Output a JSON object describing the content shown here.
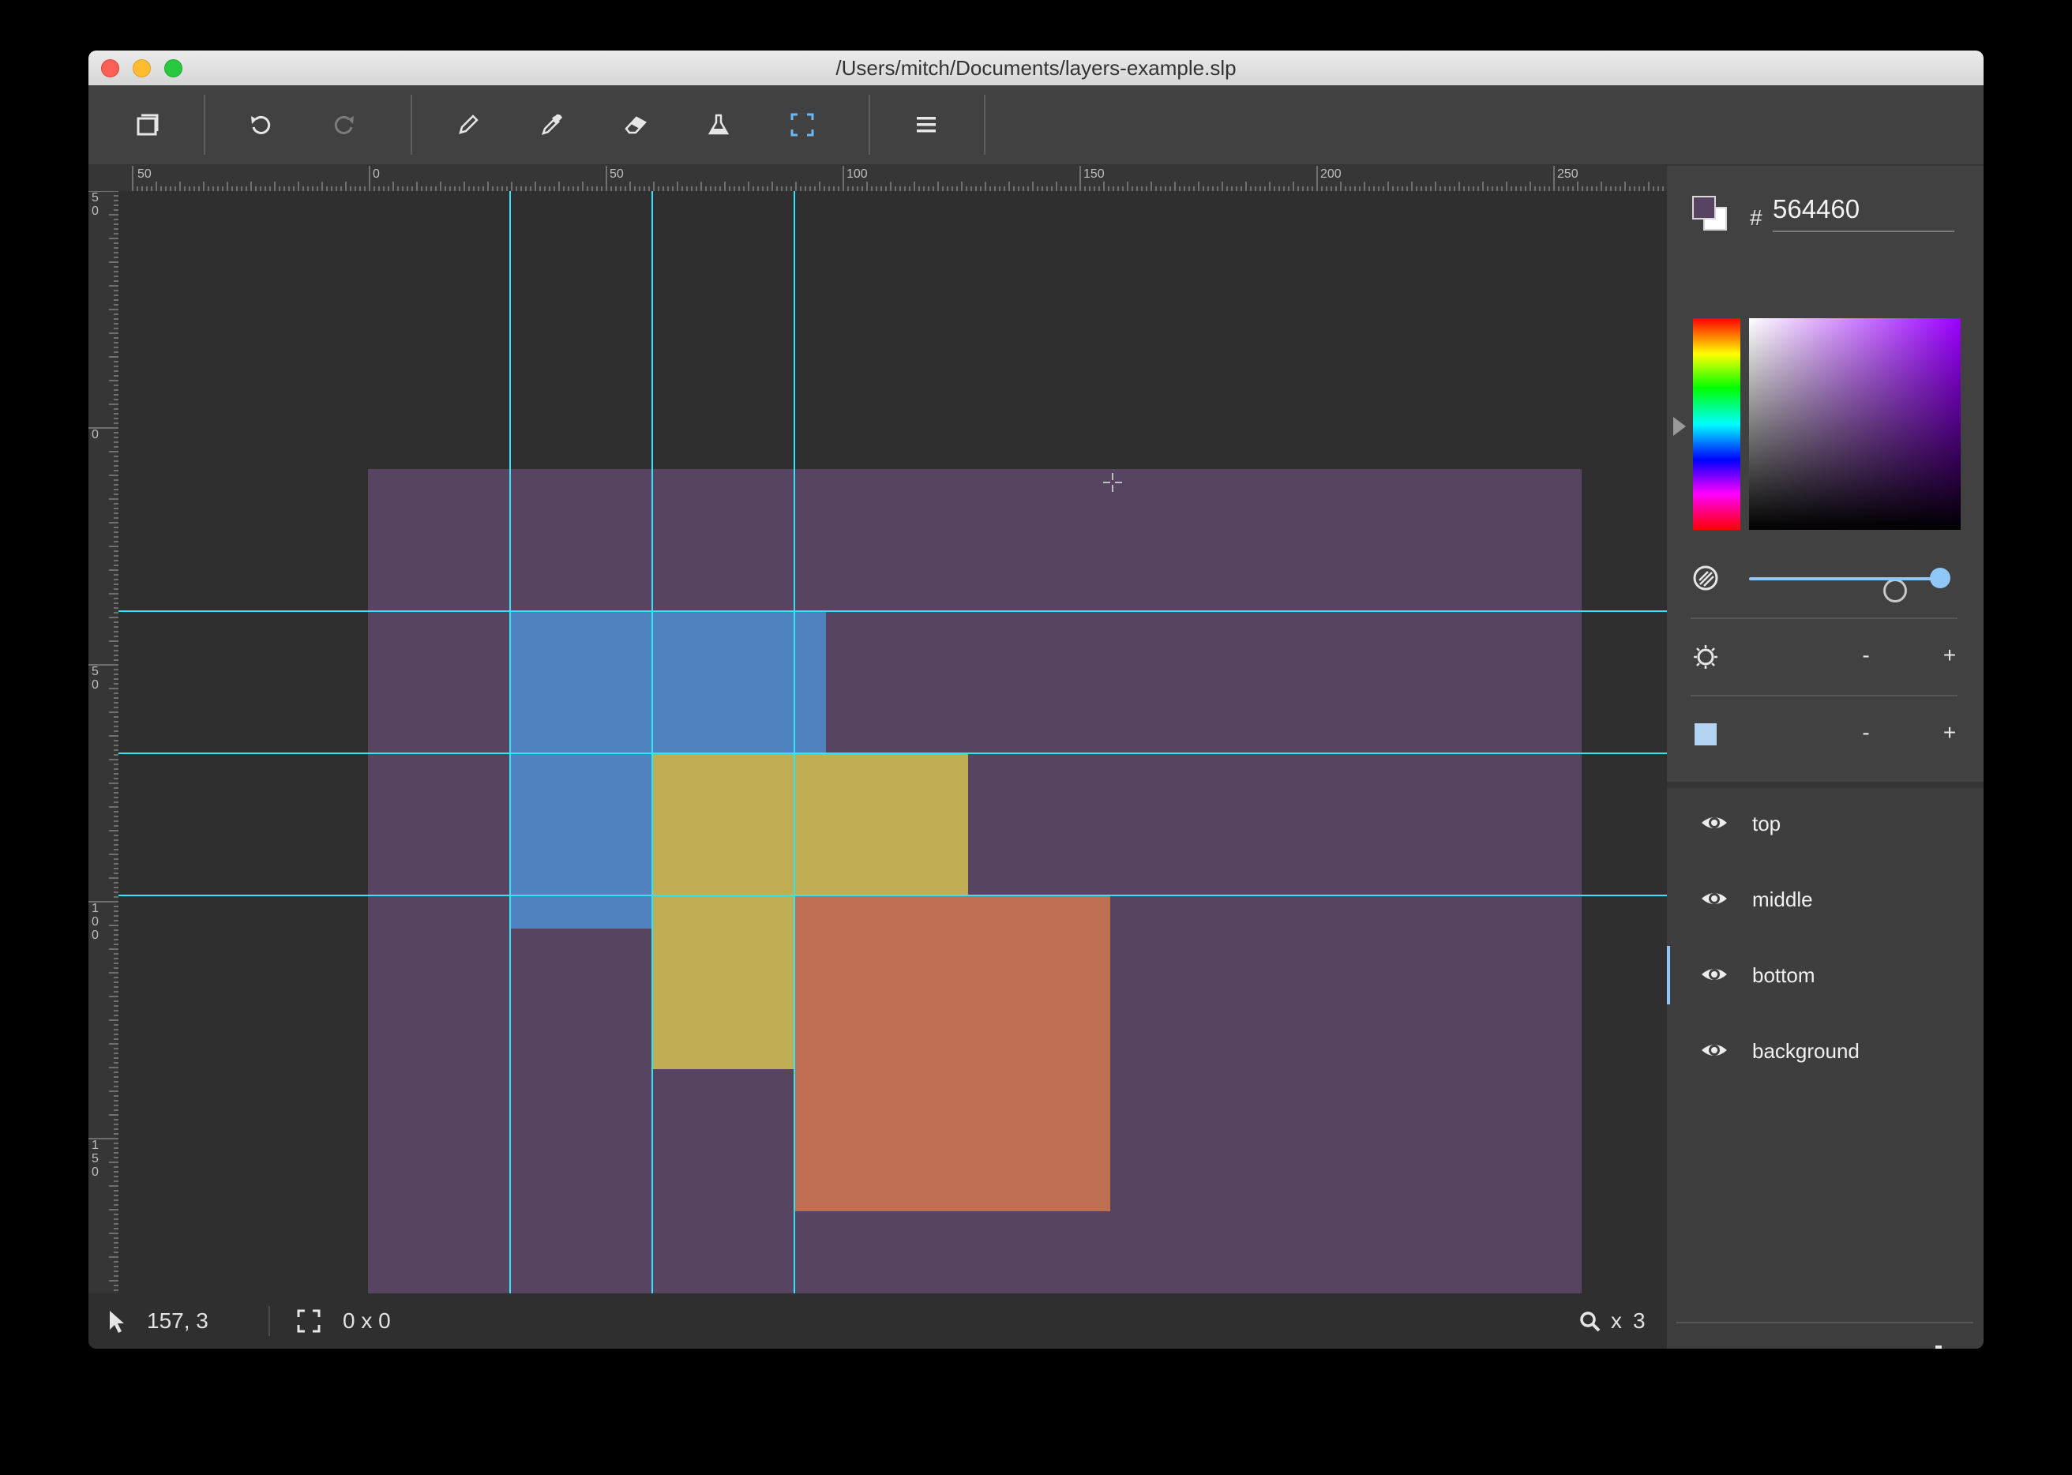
{
  "window": {
    "title": "/Users/mitch/Documents/layers-example.slp"
  },
  "toolbar": {
    "tools": [
      {
        "icon": "canvas-icon"
      },
      {
        "icon": "undo-icon"
      },
      {
        "icon": "redo-icon"
      },
      {
        "icon": "pencil-icon"
      },
      {
        "icon": "eyedropper-icon"
      },
      {
        "icon": "eraser-icon"
      },
      {
        "icon": "fill-flask-icon"
      },
      {
        "icon": "selection-icon",
        "active": true
      },
      {
        "icon": "menu-icon"
      }
    ]
  },
  "rulers": {
    "horizontal": [
      "50",
      "0",
      "50",
      "100",
      "150",
      "200",
      "250"
    ],
    "vertical": [
      "50",
      "0",
      "50",
      "100",
      "150"
    ]
  },
  "canvas": {
    "background_color": "#564460",
    "guide_color": "#2ee6f6",
    "layers_colors": {
      "top": "#5182c0",
      "middle": "#c0ae55",
      "bottom": "#c07052"
    }
  },
  "status": {
    "cursor_position": "157, 3",
    "selection_size": "0 x 0",
    "zoom_prefix": "x",
    "zoom_value": "3"
  },
  "color_panel": {
    "hash": "#",
    "hex_value": "564460",
    "opacity_level": 1.0,
    "brightness_minus": "-",
    "brightness_plus": "+",
    "size_minus": "-",
    "size_plus": "+"
  },
  "layers_panel": {
    "layers": [
      {
        "name": "top",
        "visible": true,
        "active": false
      },
      {
        "name": "middle",
        "visible": true,
        "active": false
      },
      {
        "name": "bottom",
        "visible": true,
        "active": true
      },
      {
        "name": "background",
        "visible": true,
        "active": false
      }
    ],
    "add_label": "+"
  }
}
